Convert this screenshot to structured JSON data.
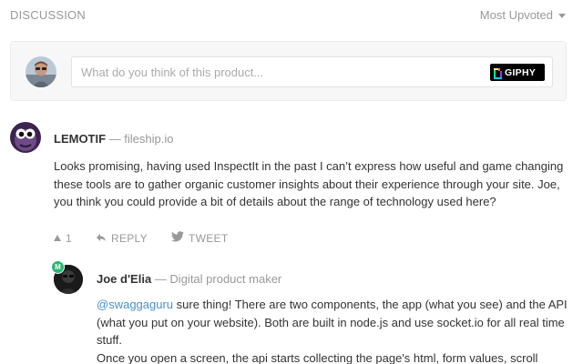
{
  "header": {
    "title": "DISCUSSION",
    "sort_label": "Most Upvoted"
  },
  "compose": {
    "placeholder": "What do you think of this product...",
    "giphy_label": "GIPHY"
  },
  "comment": {
    "author": "LEMOTIF",
    "separator": "—",
    "role": "fileship.io",
    "body": "Looks promising, having used InspectIt in the past I can’t express how useful and game changing these tools are to gather organic customer insights about their experience through your site. Joe, you think you could provide a bit of details about the range of technology used here?",
    "upvotes": "1",
    "reply_label": "REPLY",
    "tweet_label": "TWEET"
  },
  "reply": {
    "badge": "M",
    "author": "Joe d'Elia",
    "separator": "—",
    "role": "Digital product maker",
    "mention": "@swaggaguru",
    "body_line1": " sure thing! There are two components, the app (what you see) and the API (what you put on your website). Both are built in node.js and use socket.io for all real time stuff.",
    "body_line2": "Once you open a screen, the api starts collecting the page's html, form values, scroll"
  }
}
